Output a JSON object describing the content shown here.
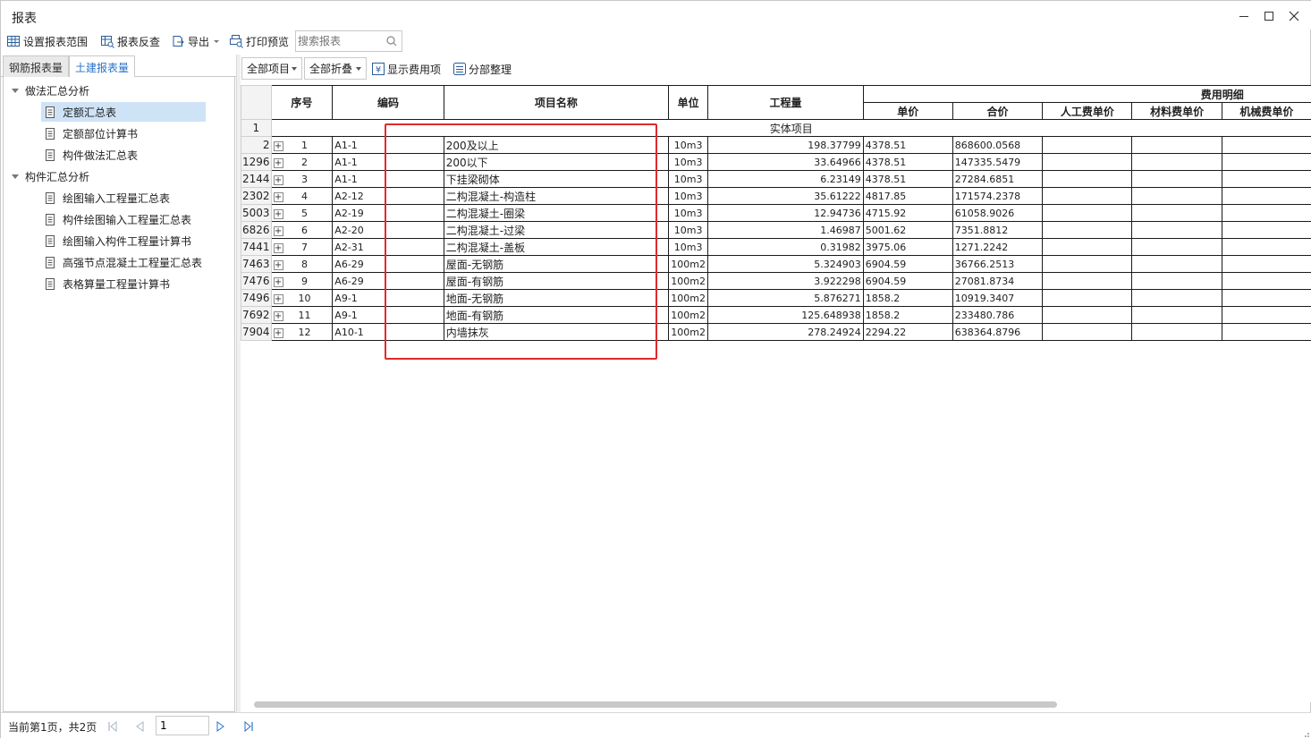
{
  "window": {
    "title": "报表"
  },
  "toolbar": {
    "set_range": "设置报表范围",
    "reverse_check": "报表反查",
    "export": "导出",
    "print_preview": "打印预览",
    "search_placeholder": "搜索报表"
  },
  "left_tabs": [
    "钢筋报表量",
    "土建报表量"
  ],
  "tree": {
    "groups": [
      {
        "label": "做法汇总分析",
        "items": [
          "定额汇总表",
          "定额部位计算书",
          "构件做法汇总表"
        ]
      },
      {
        "label": "构件汇总分析",
        "items": [
          "绘图输入工程量汇总表",
          "构件绘图输入工程量汇总表",
          "绘图输入构件工程量计算书",
          "高强节点混凝土工程量汇总表",
          "表格算量工程量计算书"
        ]
      }
    ],
    "selected": "定额汇总表"
  },
  "report_toolbar": {
    "all_items": "全部项目",
    "collapse_all": "全部折叠",
    "show_fee": "显示费用项",
    "section_sort": "分部整理"
  },
  "table": {
    "headers": {
      "seq": "序号",
      "code": "编码",
      "name": "项目名称",
      "unit": "单位",
      "qty": "工程量",
      "fee_detail": "费用明细",
      "unit_price": "单价",
      "total": "合价",
      "labor": "人工费单价",
      "material": "材料费单价",
      "machine": "机械费单价"
    },
    "section_row": {
      "row_no": "1",
      "label": "实体项目"
    },
    "rows": [
      {
        "row_no": "2",
        "seq": "1",
        "code": "A1-1",
        "name": "200及以上",
        "unit": "10m3",
        "qty": "198.37799",
        "price": "4378.51",
        "total": "868600.0568"
      },
      {
        "row_no": "1296",
        "seq": "2",
        "code": "A1-1",
        "name": "200以下",
        "unit": "10m3",
        "qty": "33.64966",
        "price": "4378.51",
        "total": "147335.5479"
      },
      {
        "row_no": "2144",
        "seq": "3",
        "code": "A1-1",
        "name": "下挂梁砌体",
        "unit": "10m3",
        "qty": "6.23149",
        "price": "4378.51",
        "total": "27284.6851"
      },
      {
        "row_no": "2302",
        "seq": "4",
        "code": "A2-12",
        "name": "二构混凝土-构造柱",
        "unit": "10m3",
        "qty": "35.61222",
        "price": "4817.85",
        "total": "171574.2378"
      },
      {
        "row_no": "5003",
        "seq": "5",
        "code": "A2-19",
        "name": "二构混凝土-圈梁",
        "unit": "10m3",
        "qty": "12.94736",
        "price": "4715.92",
        "total": "61058.9026"
      },
      {
        "row_no": "6826",
        "seq": "6",
        "code": "A2-20",
        "name": "二构混凝土-过梁",
        "unit": "10m3",
        "qty": "1.46987",
        "price": "5001.62",
        "total": "7351.8812"
      },
      {
        "row_no": "7441",
        "seq": "7",
        "code": "A2-31",
        "name": "二构混凝土-盖板",
        "unit": "10m3",
        "qty": "0.31982",
        "price": "3975.06",
        "total": "1271.2242"
      },
      {
        "row_no": "7463",
        "seq": "8",
        "code": "A6-29",
        "name": "屋面-无钢筋",
        "unit": "100m2",
        "qty": "5.324903",
        "price": "6904.59",
        "total": "36766.2513"
      },
      {
        "row_no": "7476",
        "seq": "9",
        "code": "A6-29",
        "name": "屋面-有钢筋",
        "unit": "100m2",
        "qty": "3.922298",
        "price": "6904.59",
        "total": "27081.8734"
      },
      {
        "row_no": "7496",
        "seq": "10",
        "code": "A9-1",
        "name": "地面-无钢筋",
        "unit": "100m2",
        "qty": "5.876271",
        "price": "1858.2",
        "total": "10919.3407"
      },
      {
        "row_no": "7692",
        "seq": "11",
        "code": "A9-1",
        "name": "地面-有钢筋",
        "unit": "100m2",
        "qty": "125.648938",
        "price": "1858.2",
        "total": "233480.786"
      },
      {
        "row_no": "7904",
        "seq": "12",
        "code": "A10-1",
        "name": "内墙抹灰",
        "unit": "100m2",
        "qty": "278.24924",
        "price": "2294.22",
        "total": "638364.8796"
      }
    ]
  },
  "status": {
    "page_info": "当前第1页，共2页",
    "page_value": "1"
  },
  "colors": {
    "accent": "#2a72c8",
    "highlight": "#e02a2a",
    "selected_bg": "#cfe3f7"
  },
  "icons": [
    "grid-range-icon",
    "reverse-check-icon",
    "export-icon",
    "print-preview-icon",
    "search-icon",
    "yen-icon",
    "section-sort-icon",
    "document-icon"
  ]
}
